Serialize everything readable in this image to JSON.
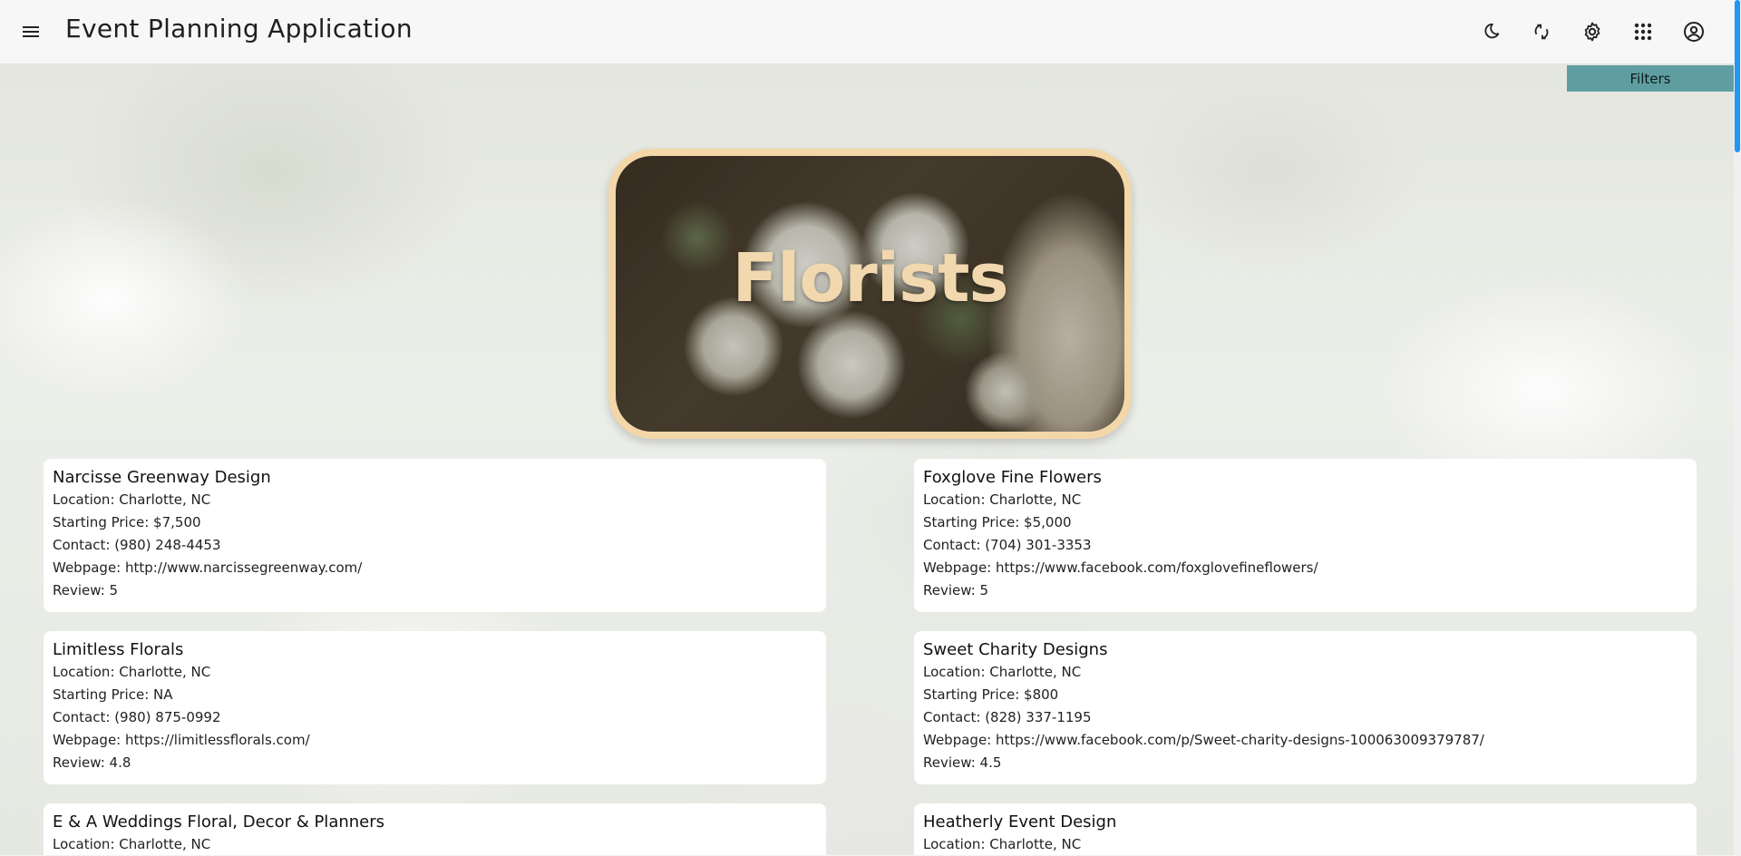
{
  "header": {
    "title": "Event Planning Application",
    "icons": [
      "menu-icon",
      "moon-icon",
      "sync-icon",
      "gear-icon",
      "apps-grid-icon",
      "account-icon"
    ]
  },
  "filters_label": "Filters",
  "hero": {
    "title": "Florists"
  },
  "labels": {
    "location": "Location:",
    "price": "Starting Price:",
    "contact": "Contact:",
    "webpage": "Webpage:",
    "review": "Review:"
  },
  "vendors": [
    {
      "name": "Narcisse Greenway Design",
      "location": "Charlotte, NC",
      "price": "$7,500",
      "contact": "(980) 248-4453",
      "webpage": "http://www.narcissegreenway.com/",
      "review": "5"
    },
    {
      "name": "Foxglove Fine Flowers",
      "location": "Charlotte, NC",
      "price": "$5,000",
      "contact": "(704) 301-3353",
      "webpage": "https://www.facebook.com/foxglovefineflowers/",
      "review": "5"
    },
    {
      "name": "Limitless Florals",
      "location": "Charlotte, NC",
      "price": "NA",
      "contact": "(980) 875-0992",
      "webpage": "https://limitlessflorals.com/",
      "review": "4.8"
    },
    {
      "name": "Sweet Charity Designs",
      "location": "Charlotte, NC",
      "price": "$800",
      "contact": "(828) 337-1195",
      "webpage": "https://www.facebook.com/p/Sweet-charity-designs-100063009379787/",
      "review": "4.5"
    },
    {
      "name": "E & A Weddings Floral, Decor & Planners",
      "location": "Charlotte, NC"
    },
    {
      "name": "Heatherly Event Design",
      "location": "Charlotte, NC"
    }
  ]
}
